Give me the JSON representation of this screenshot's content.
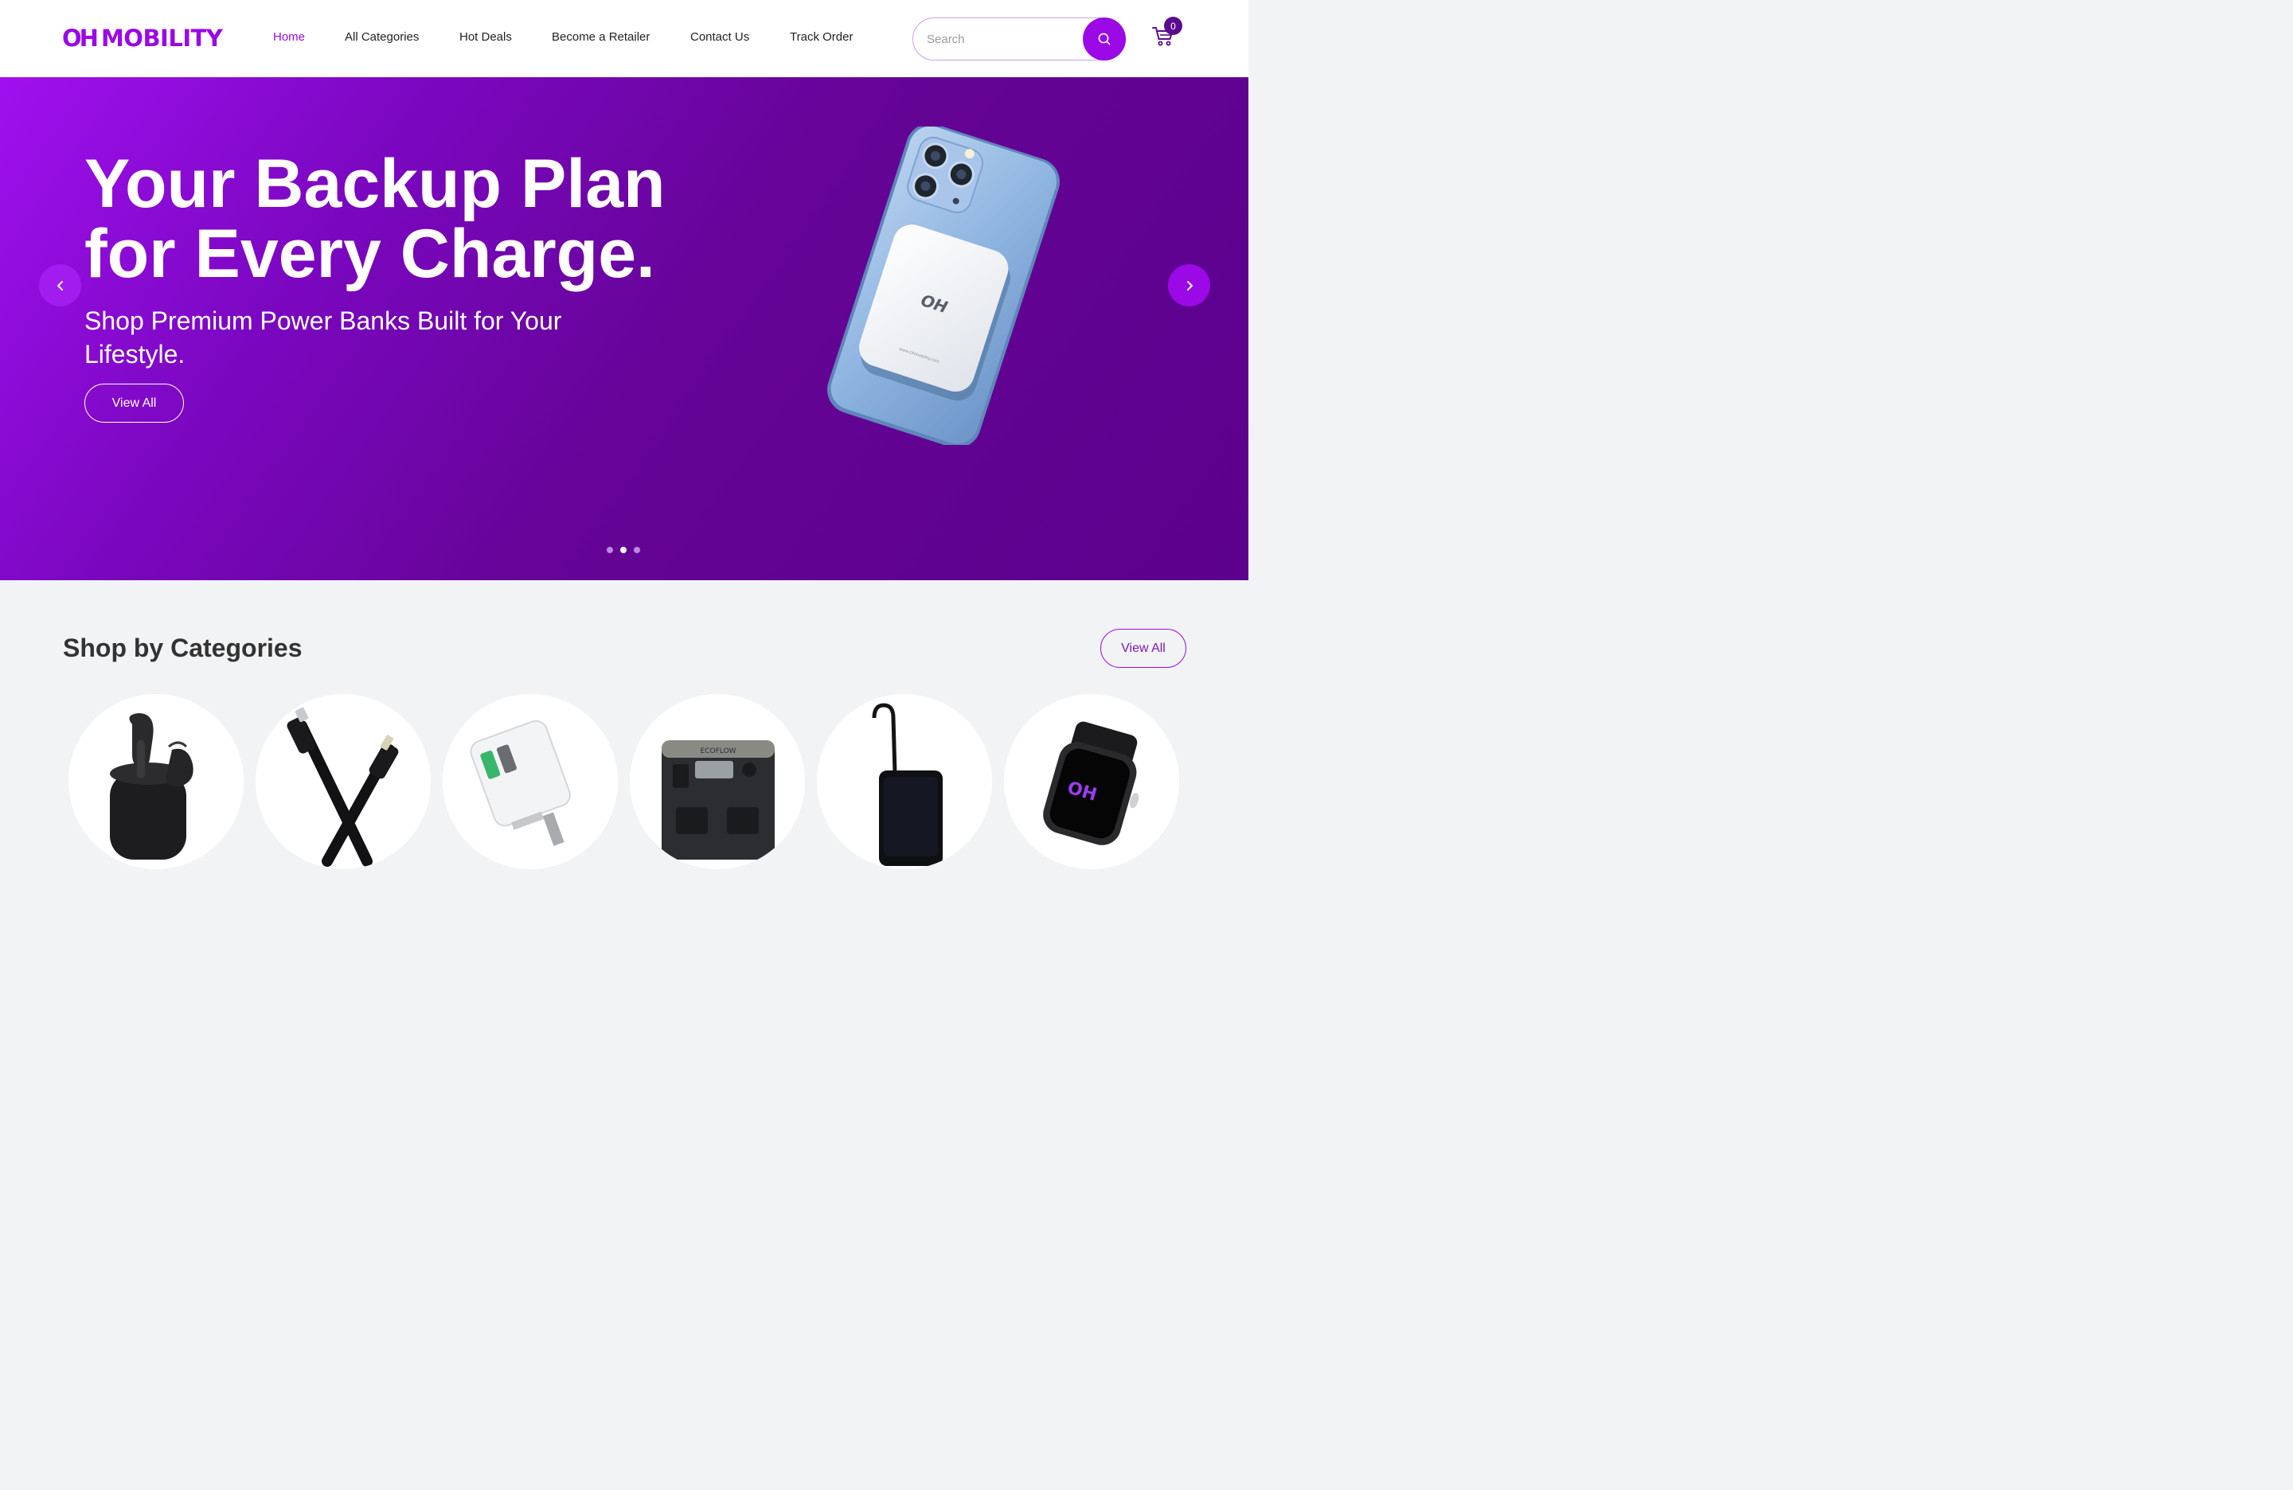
{
  "brand": {
    "logo_oh": "OH",
    "logo_text": "MOBILITY",
    "accent": "#9a09e6",
    "dark_accent": "#5a0c8f"
  },
  "nav": {
    "items": [
      {
        "label": "Home",
        "active": true
      },
      {
        "label": "All Categories",
        "active": false
      },
      {
        "label": "Hot Deals",
        "active": false
      },
      {
        "label": "Become a Retailer",
        "active": false
      },
      {
        "label": "Contact Us",
        "active": false
      },
      {
        "label": "Track Order",
        "active": false
      }
    ]
  },
  "search": {
    "placeholder": "Search",
    "value": "",
    "icon": "search-icon"
  },
  "cart": {
    "icon": "cart-icon",
    "count": "0"
  },
  "hero": {
    "title_line1": "Your Backup Plan",
    "title_line2": "for Every Charge.",
    "subtitle": "Shop Premium Power Banks Built for Your Lifestyle.",
    "button_label": "View All",
    "prev_icon": "chevron-left-icon",
    "next_icon": "chevron-right-icon",
    "slide_count": 3,
    "active_slide": 2,
    "product_mark": "OH",
    "product_url_text": "www.OHmobility.com"
  },
  "categories": {
    "title": "Shop by Categories",
    "view_all_label": "View All",
    "items": [
      {
        "image": "earbuds-image"
      },
      {
        "image": "cable-image"
      },
      {
        "image": "charger-image"
      },
      {
        "image": "power-station-image",
        "brand_text": "ECOFLOW"
      },
      {
        "image": "power-bank-image"
      },
      {
        "image": "smartwatch-image",
        "screen_text": "OH"
      }
    ]
  }
}
